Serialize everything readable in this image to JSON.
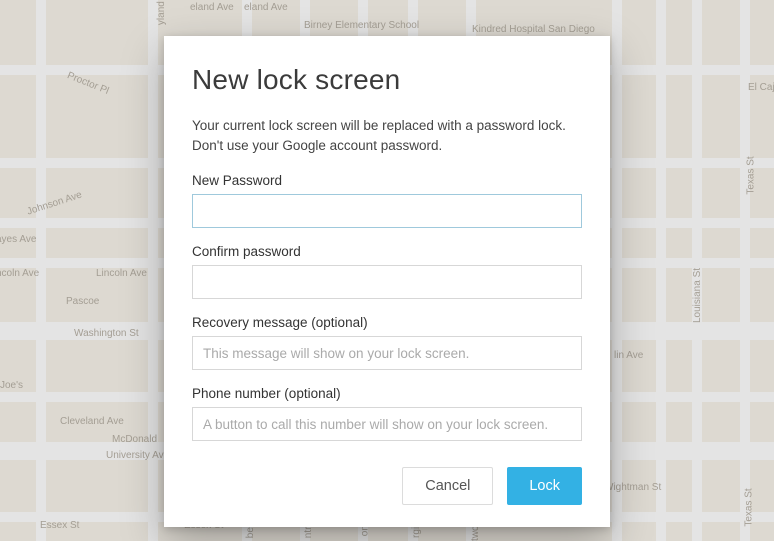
{
  "dialog": {
    "title": "New lock screen",
    "description": "Your current lock screen will be replaced with a password lock. Don't use your Google account password.",
    "fields": {
      "new_password": {
        "label": "New Password",
        "value": "",
        "placeholder": ""
      },
      "confirm_password": {
        "label": "Confirm password",
        "value": "",
        "placeholder": ""
      },
      "recovery_message": {
        "label": "Recovery message (optional)",
        "value": "",
        "placeholder": "This message will show on your lock screen."
      },
      "phone_number": {
        "label": "Phone number (optional)",
        "value": "",
        "placeholder": "A button to call this number will show on your lock screen."
      }
    },
    "buttons": {
      "cancel": "Cancel",
      "lock": "Lock"
    }
  },
  "map": {
    "labels": [
      "Johnson Ave",
      "Proctor Pl",
      "ayes Ave",
      "ncoln Ave",
      "Lincoln Ave",
      "Pascoe",
      "Washington St",
      "Joe's",
      "Cleveland Ave",
      "University Av",
      "Essex St",
      "McDonald",
      "Essex St",
      "bert St",
      "ntre St",
      "ona A",
      "rgia St",
      "twood St",
      "Birney Elementary School",
      "Kindred Hospital San Diego",
      "eland Ave",
      "eland Ave",
      "El Caj",
      "Texas St",
      "Texas St",
      "Louisiana St",
      "Wightman St",
      "lin Ave",
      "yland Ave"
    ]
  },
  "colors": {
    "primary": "#33b1e4",
    "map_bg": "#f7f3ea",
    "road": "#ffffff",
    "label": "#b7b0a4"
  }
}
